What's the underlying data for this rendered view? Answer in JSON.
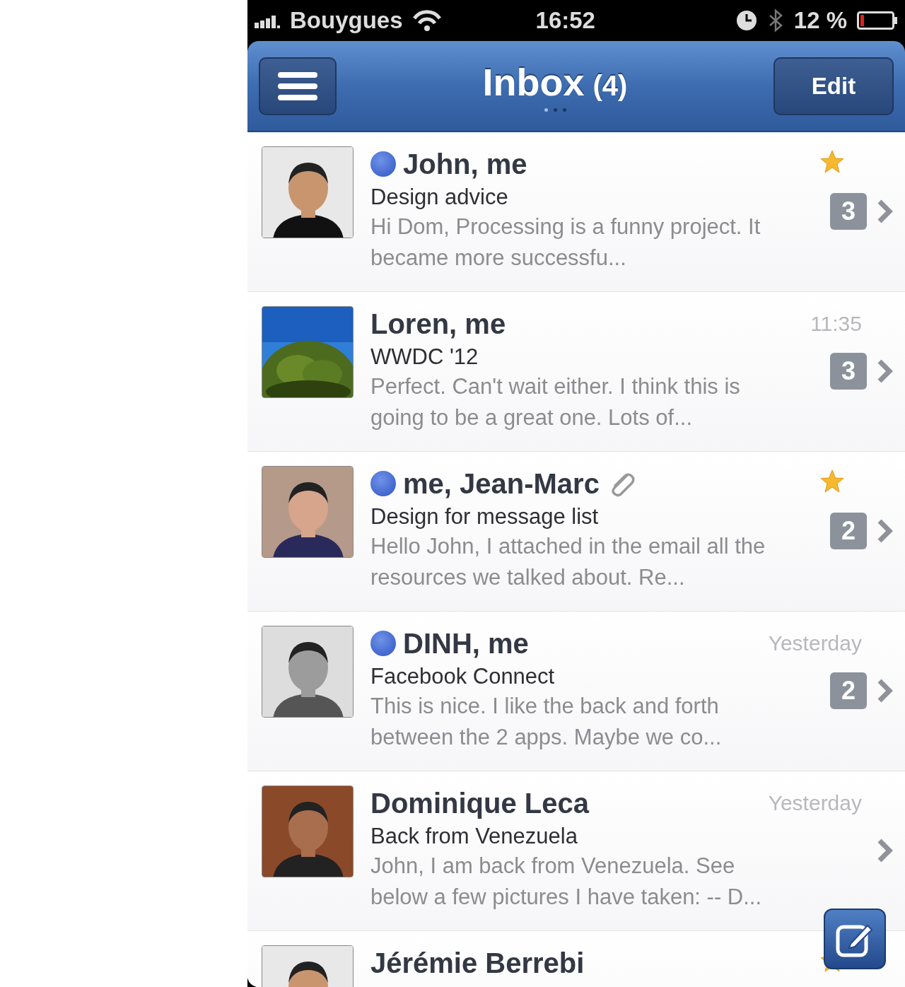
{
  "status_bar": {
    "carrier": "Bouygues",
    "time": "16:52",
    "battery": "12 %"
  },
  "nav_bar": {
    "title": "Inbox",
    "count": "(4)",
    "edit_button": "Edit",
    "page_dots": [
      {
        "selected": true
      },
      {
        "selected": false
      },
      {
        "selected": false
      }
    ]
  },
  "messages": [
    {
      "sender": "John, me",
      "unread": true,
      "starred": true,
      "attachment": false,
      "subject": "Design advice",
      "preview": "Hi Dom, Processing is a funny project. It became more successfu...",
      "count": "3"
    },
    {
      "sender": "Loren, me",
      "unread": false,
      "starred": false,
      "attachment": false,
      "time": "11:35",
      "subject": "WWDC '12",
      "preview": "Perfect. Can't wait either. I think this is going to be a great one. Lots of...",
      "count": "3"
    },
    {
      "sender": "me, Jean-Marc",
      "unread": true,
      "starred": true,
      "attachment": true,
      "subject": "Design for message list",
      "preview": "Hello John, I attached in the email all the resources we talked about. Re...",
      "count": "2"
    },
    {
      "sender": "DINH, me",
      "unread": true,
      "starred": false,
      "attachment": false,
      "time": "Yesterday",
      "subject": "Facebook Connect",
      "preview": "This is nice. I like the back and forth between the 2 apps. Maybe we co...",
      "count": "2"
    },
    {
      "sender": "Dominique Leca",
      "unread": false,
      "starred": false,
      "attachment": false,
      "time": "Yesterday",
      "subject": "Back from Venezuela",
      "preview": "John, I am back from Venezuela. See below a few pictures I have taken: -- D..."
    },
    {
      "sender": "Jérémie Berrebi",
      "unread": false,
      "starred": true,
      "attachment": false
    }
  ]
}
